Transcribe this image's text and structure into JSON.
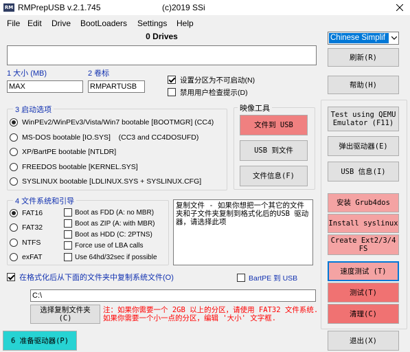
{
  "title_bar": {
    "icon_text": "RM",
    "title": "RMPrepUSB v.2.1.745",
    "copyright": "(c)2019 SSi"
  },
  "icons": {
    "app": "rm-logo-icon",
    "close": "close-icon",
    "dropdown": "chevron-down-icon",
    "checkbox": "check-icon",
    "radio": "radio-dot-icon"
  },
  "menu": [
    "File",
    "Edit",
    "Drive",
    "BootLoaders",
    "Settings",
    "Help"
  ],
  "drives": {
    "label": "0 Drives"
  },
  "language": {
    "selected": "Chinese Simplif"
  },
  "top_buttons": {
    "refresh": "刷新(R)",
    "help": "帮助(H)"
  },
  "size": {
    "label": "1 大小 (MB)",
    "value": "MAX"
  },
  "volume": {
    "label": "2 卷标",
    "value": "RMPARTUSB"
  },
  "options": [
    {
      "label": "设置分区为不可启动(N)",
      "checked": true
    },
    {
      "label": "禁用用户检查提示(D)",
      "checked": false
    }
  ],
  "boot_options": {
    "title": "3 启动选项",
    "items": [
      {
        "label": "WinPEv2/WinPEv3/Vista/Win7 bootable [BOOTMGR] (CC4)",
        "selected": true
      },
      {
        "label": "MS-DOS bootable [IO.SYS]    (CC3 and CC4DOSUFD)",
        "selected": false
      },
      {
        "label": "XP/BartPE bootable [NTLDR]",
        "selected": false
      },
      {
        "label": "FREEDOS bootable [KERNEL.SYS]",
        "selected": false
      },
      {
        "label": "SYSLINUX bootable [LDLINUX.SYS + SYSLINUX.CFG]",
        "selected": false
      }
    ]
  },
  "image_tools": {
    "title": "映像工具",
    "file_to_usb": "文件到 USB",
    "usb_to_file": "USB 到文件",
    "file_info": "文件信息(F)"
  },
  "side_buttons": {
    "qemu": [
      "Test using QEMU",
      "Emulator (F11)"
    ],
    "eject": "弹出驱动器(E)",
    "usb_info": "USB 信息(I)",
    "grub4dos": "安装 Grub4dos",
    "syslinux": "Install syslinux",
    "ext_fs": [
      "Create Ext2/3/4",
      "FS"
    ],
    "speed_test": "速度测试 (T)",
    "test": "测试(T)",
    "clean": "清理(C)",
    "exit": "退出(X)"
  },
  "filesystem": {
    "title": "4 文件系统和引导",
    "types": [
      {
        "label": "FAT16",
        "selected": true
      },
      {
        "label": "FAT32",
        "selected": false
      },
      {
        "label": "NTFS",
        "selected": false
      },
      {
        "label": "exFAT",
        "selected": false
      }
    ],
    "boot_flags": [
      {
        "label": "Boot as FDD (A: no MBR)",
        "checked": false
      },
      {
        "label": "Boot as ZIP (A: with MBR)",
        "checked": false
      },
      {
        "label": "Boot as HDD (C: 2PTNS)",
        "checked": false
      },
      {
        "label": "Force use of LBA calls",
        "checked": false
      },
      {
        "label": "Use 64hd/32sec if possible",
        "checked": false
      }
    ]
  },
  "help_text": "复制文件 - 如果你想把一个其它的文件夹和子文件夹复制到格式化后的USB 驱动器，请选择此项",
  "copy_files": {
    "label": "在格式化后从下面的文件夹中复制系统文件(O)",
    "checked": true,
    "path": "C:\\",
    "choose_button": [
      "选择复制文件夹",
      "(C)"
    ]
  },
  "bartpe": {
    "label": "BartPE 到 USB",
    "checked": false
  },
  "note": "注：如果你需要一个 2GB 以上的分区，请使用 FAT32 文件系统. 如果你需要一个小一点的分区，编辑 '大小' 文字框.",
  "prepare_button": "6 准备驱动器(P)",
  "colors": {
    "background": "#f0f0f0",
    "accent": "#0078d7",
    "label_blue": "#1030b0",
    "pink_button": "#f4a3a3",
    "salmon_button": "#f08080",
    "red_button": "#f07272",
    "prepare_button": "#27d3d3",
    "note_red": "#ff0000"
  }
}
